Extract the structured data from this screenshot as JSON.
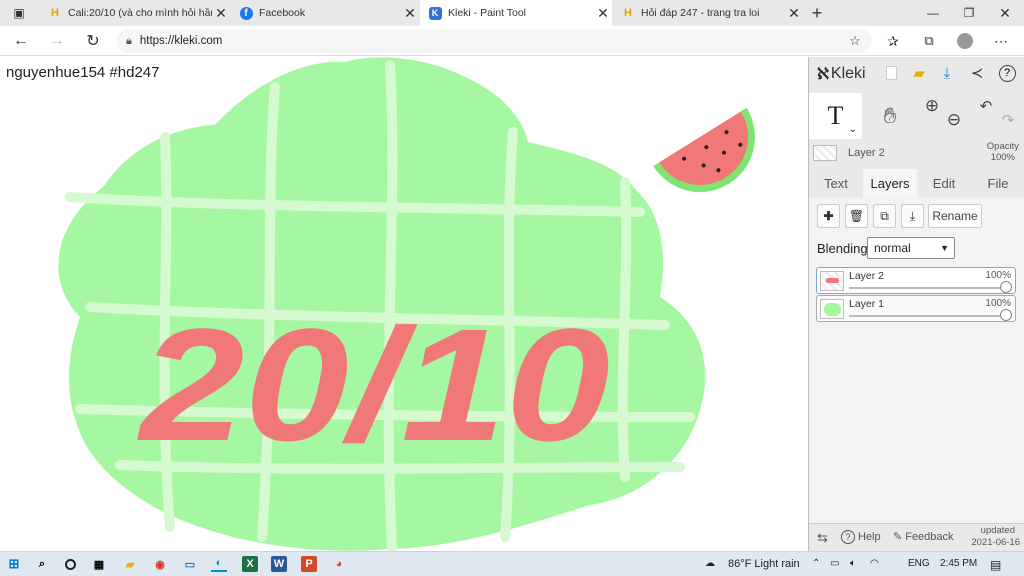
{
  "browser": {
    "tabs": [
      {
        "title": "Cali:20/10 (và cho mình hỏi hầu",
        "icon": "hoidap-favicon-icon"
      },
      {
        "title": "Facebook",
        "icon": "facebook-icon"
      },
      {
        "title": "Kleki - Paint Tool",
        "icon": "kleki-favicon-icon",
        "active": true
      },
      {
        "title": "Hỏi đáp 247 - trang tra loi",
        "icon": "hoidap-favicon-icon"
      }
    ],
    "url": "https://kleki.com"
  },
  "canvas": {
    "watermark": "nguyenhue154  #hd247",
    "artwork_text": "20/10",
    "colors": {
      "blob": "#a6f7a2",
      "grid": "#d6f9d2",
      "text": "#f07878",
      "watermelon_rind": "#7ee472",
      "watermelon_flesh": "#f07878"
    }
  },
  "kleki": {
    "logo": "Kleki",
    "tool": "T",
    "current_layer": "Layer 2",
    "opacity_label": "Opacity",
    "opacity_value": "100%",
    "tabs": [
      "Text",
      "Layers",
      "Edit",
      "File"
    ],
    "active_tab": "Layers",
    "rename_label": "Rename",
    "blending_label": "Blending",
    "blending_value": "normal",
    "layers": [
      {
        "name": "Layer 2",
        "opacity": "100%",
        "selected": true
      },
      {
        "name": "Layer 1",
        "opacity": "100%",
        "selected": false
      }
    ],
    "footer": {
      "help": "Help",
      "feedback": "Feedback",
      "updated_label": "updated",
      "updated_date": "2021-06-16"
    }
  },
  "taskbar": {
    "weather": "86°F  Light rain",
    "language": "ENG",
    "time": "2:45 PM"
  }
}
